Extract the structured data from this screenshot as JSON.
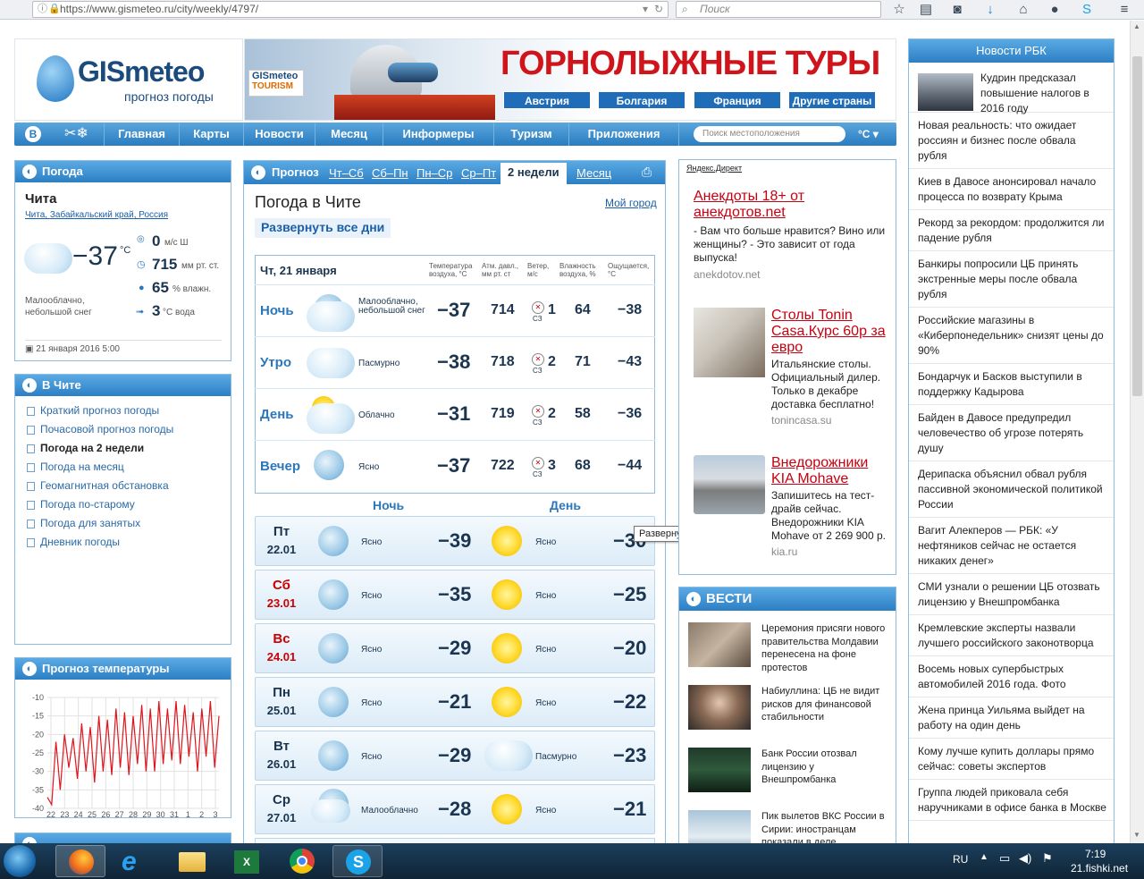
{
  "browser": {
    "url": "https://www.gismeteo.ru/city/weekly/4797/",
    "search_placeholder": "Поиск"
  },
  "header": {
    "logo_name": "GISmeteo",
    "logo_sub": "прогноз погоды",
    "banner_badge_1": "GISmeteo",
    "banner_badge_2": "TOURISM",
    "banner_title": "ГОРНОЛЫЖНЫЕ ТУРЫ",
    "banner_buttons": [
      "Австрия",
      "Болгария",
      "Франция",
      "Другие страны"
    ]
  },
  "nav": {
    "items": [
      "Главная",
      "Карты",
      "Новости",
      "Месяц",
      "Информеры",
      "Туризм",
      "Приложения"
    ],
    "search_placeholder": "Поиск местоположения",
    "unit": "°C"
  },
  "weather_panel": {
    "title": "Погода",
    "city": "Чита",
    "breadcrumb": [
      "Чита",
      "Забайкальский край",
      "Россия"
    ],
    "temp": "−37",
    "temp_unit": "°C",
    "wind": "0",
    "wind_unit": "м/с  Ш",
    "pressure": "715",
    "pressure_unit": "мм рт. ст.",
    "humidity": "65",
    "humidity_unit": "% влажн.",
    "water": "3",
    "water_unit": "°C вода",
    "desc": "Малооблачно, небольшой снег",
    "date": "21 января 2016 5:00"
  },
  "city_panel": {
    "title": "В Чите",
    "links": [
      "Краткий прогноз погоды",
      "Почасовой прогноз погоды",
      "Погода на 2 недели",
      "Погода на месяц",
      "Геомагнитная обстановка",
      "Погода по-старому",
      "Погода для занятых",
      "Дневник погоды"
    ],
    "active_index": 2
  },
  "temp_chart": {
    "title": "Прогноз температуры"
  },
  "chart_data": {
    "type": "line",
    "title": "Прогноз температуры",
    "y_ticks": [
      "-10",
      "-15",
      "-20",
      "-25",
      "-30",
      "-35",
      "-40"
    ],
    "ylim": [
      -40,
      -10
    ],
    "x_ticks": [
      "22",
      "23",
      "24",
      "25",
      "26",
      "27",
      "28",
      "29",
      "30",
      "31",
      "1",
      "2",
      "3"
    ],
    "values": [
      -37,
      -39,
      -22,
      -35,
      -20,
      -29,
      -21,
      -32,
      -17,
      -30,
      -18,
      -33,
      -15,
      -30,
      -16,
      -31,
      -13,
      -29,
      -14,
      -31,
      -15,
      -28,
      -12,
      -30,
      -13,
      -30,
      -11,
      -28,
      -13,
      -27,
      -11,
      -28,
      -12,
      -26,
      -14,
      -30,
      -13,
      -26,
      -11,
      -29,
      -15
    ]
  },
  "forecast": {
    "tabs": [
      "Прогноз",
      "Чт–Сб",
      "Сб–Пн",
      "Пн–Ср",
      "Ср–Пт",
      "2 недели",
      "Месяц"
    ],
    "active_tab": "2 недели",
    "title": "Погода в Чите",
    "my_city": "Мой город",
    "expand_all": "Развернуть все дни",
    "day_title": "Чт, 21 января",
    "col_headers": [
      "Температура воздуха, °C",
      "Атм. давл., мм рт. ст",
      "Ветер, м/с",
      "Влажность воздуха, %",
      "Ощущается, °C"
    ],
    "periods": [
      {
        "name": "Ночь",
        "desc": "Малооблачно, небольшой снег",
        "temp": "−37",
        "pressure": "714",
        "wind_dir": "СЗ",
        "wind": "1",
        "humidity": "64",
        "feels": "−38"
      },
      {
        "name": "Утро",
        "desc": "Пасмурно",
        "temp": "−38",
        "pressure": "718",
        "wind_dir": "СЗ",
        "wind": "2",
        "humidity": "71",
        "feels": "−43"
      },
      {
        "name": "День",
        "desc": "Облачно",
        "temp": "−31",
        "pressure": "719",
        "wind_dir": "СЗ",
        "wind": "2",
        "humidity": "58",
        "feels": "−36"
      },
      {
        "name": "Вечер",
        "desc": "Ясно",
        "temp": "−37",
        "pressure": "722",
        "wind_dir": "СЗ",
        "wind": "3",
        "humidity": "68",
        "feels": "−44"
      }
    ],
    "night_label": "Ночь",
    "day_label": "День",
    "tooltip": "Развернуть",
    "days": [
      {
        "dow": "Пт",
        "date": "22.01",
        "weekend": false,
        "night_desc": "Ясно",
        "night_temp": "−39",
        "day_desc": "Ясно",
        "day_temp": "−30"
      },
      {
        "dow": "Сб",
        "date": "23.01",
        "weekend": true,
        "night_desc": "Ясно",
        "night_temp": "−35",
        "day_desc": "Ясно",
        "day_temp": "−25"
      },
      {
        "dow": "Вс",
        "date": "24.01",
        "weekend": true,
        "night_desc": "Ясно",
        "night_temp": "−29",
        "day_desc": "Ясно",
        "day_temp": "−20"
      },
      {
        "dow": "Пн",
        "date": "25.01",
        "weekend": false,
        "night_desc": "Ясно",
        "night_temp": "−21",
        "day_desc": "Ясно",
        "day_temp": "−22"
      },
      {
        "dow": "Вт",
        "date": "26.01",
        "weekend": false,
        "night_desc": "Ясно",
        "night_temp": "−29",
        "day_desc": "Пасмурно",
        "day_temp": "−23"
      },
      {
        "dow": "Ср",
        "date": "27.01",
        "weekend": false,
        "night_desc": "Малооблачно",
        "night_temp": "−28",
        "day_desc": "Ясно",
        "day_temp": "−21"
      }
    ]
  },
  "ads": {
    "label": "Яндекс.Директ",
    "items": [
      {
        "title": "Анекдоты 18+ от анекдотов.net",
        "text": "- Вам что больше нравится? Вино или женщины? - Это зависит от года выпуска!",
        "url": "anekdotov.net"
      },
      {
        "title": "Столы Tonin Casa.Курс 60р за евро",
        "text": "Итальянские столы. Официальный дилер. Только в декабре доставка бесплатно!",
        "url": "tonincasa.su"
      },
      {
        "title": "Внедорожники KIA Mohave",
        "text": "Запишитесь на тест-драйв сейчас. Внедорожники KIA Mohave от 2 269 900 р.",
        "url": "kia.ru"
      }
    ]
  },
  "vesti": {
    "title": "ВЕСТИ",
    "items": [
      "Церемония присяги нового правительства Молдавии перенесена на фоне протестов",
      "Набиуллина: ЦБ не видит рисков для финансовой стабильности",
      "Банк России отозвал лицензию у Внешпромбанка",
      "Пик вылетов ВКС России в Сирии: иностранцам показали в деле"
    ]
  },
  "news": {
    "title": "Новости РБК",
    "items": [
      "Кудрин предсказал повышение налогов в 2016 году",
      "Новая реальность: что ожидает россиян и бизнес после обвала рубля",
      "Киев в Давосе анонсировал начало процесса по возврату Крыма",
      "Рекорд за рекордом: продолжится ли падение рубля",
      "Банкиры попросили ЦБ принять экстренные меры после обвала рубля",
      "Российские магазины в «Киберпонедельник» снизят цены до 90%",
      "Бондарчук и Басков выступили в поддержку Кадырова",
      "Байден в Давосе предупредил человечество об угрозе потерять душу",
      "Дерипаска объяснил обвал рубля пассивной экономической политикой России",
      "Вагит Алекперов — РБК: «У нефтяников сейчас не остается никаких денег»",
      "СМИ узнали о решении ЦБ отозвать лицензию у Внешпромбанка",
      "Кремлевские эксперты назвали лучшего российского законотворца",
      "Восемь новых супербыстрых автомобилей 2016 года. Фото",
      "Жена принца Уильяма выйдет на работу на один день",
      "Кому лучше купить доллары прямо сейчас: советы экспертов",
      "Группа людей приковала себя наручниками в офисе банка в Москве"
    ]
  },
  "taskbar": {
    "lang": "RU",
    "time": "7:19",
    "watermark": "21.fishki.net"
  }
}
